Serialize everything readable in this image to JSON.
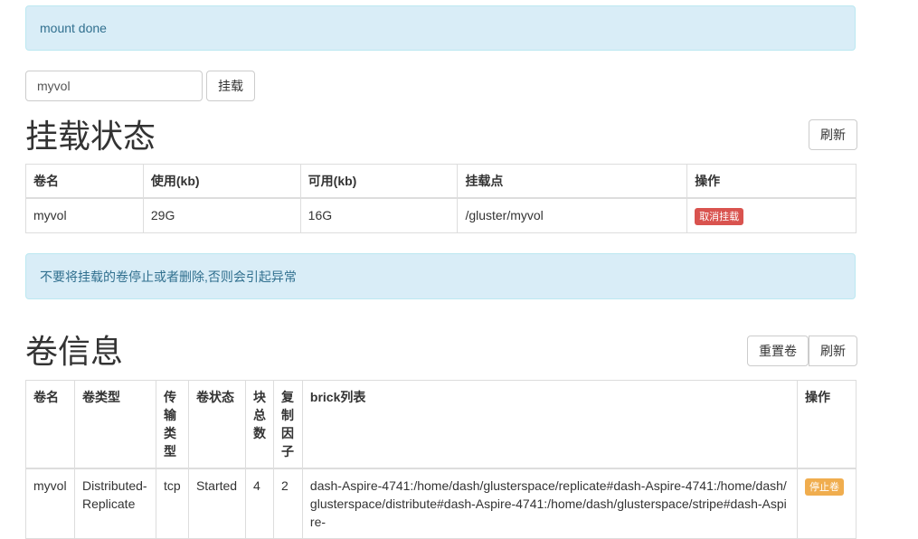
{
  "alerts": {
    "mount_status": "mount done",
    "warning": "不要将挂载的卷停止或者删除,否则会引起异常"
  },
  "mount_form": {
    "volume_value": "myvol",
    "mount_button": "挂载"
  },
  "mount_section": {
    "title": "挂载状态",
    "refresh_button": "刷新",
    "columns": [
      "卷名",
      "使用(kb)",
      "可用(kb)",
      "挂载点",
      "操作"
    ],
    "rows": [
      {
        "name": "myvol",
        "used": "29G",
        "available": "16G",
        "mount_point": "/gluster/myvol",
        "action": "取消挂载"
      }
    ]
  },
  "volume_section": {
    "title": "卷信息",
    "reset_button": "重置卷",
    "refresh_button": "刷新",
    "columns": [
      "卷名",
      "卷类型",
      "传输类型",
      "卷状态",
      "块总数",
      "复制因子",
      "brick列表",
      "操作"
    ],
    "rows": [
      {
        "name": "myvol",
        "type": "Distributed-Replicate",
        "transport": "tcp",
        "status": "Started",
        "brick_count": "4",
        "replica": "2",
        "bricks": "dash-Aspire-4741:/home/dash/glusterspace/replicate#dash-Aspire-4741:/home/dash/glusterspace/distribute#dash-Aspire-4741:/home/dash/glusterspace/stripe#dash-Aspire-",
        "action": "停止卷"
      }
    ]
  },
  "colors": {
    "alert_bg": "#d9edf7",
    "alert_text": "#31708f",
    "danger": "#d9534f",
    "warning": "#f0ad4e"
  }
}
